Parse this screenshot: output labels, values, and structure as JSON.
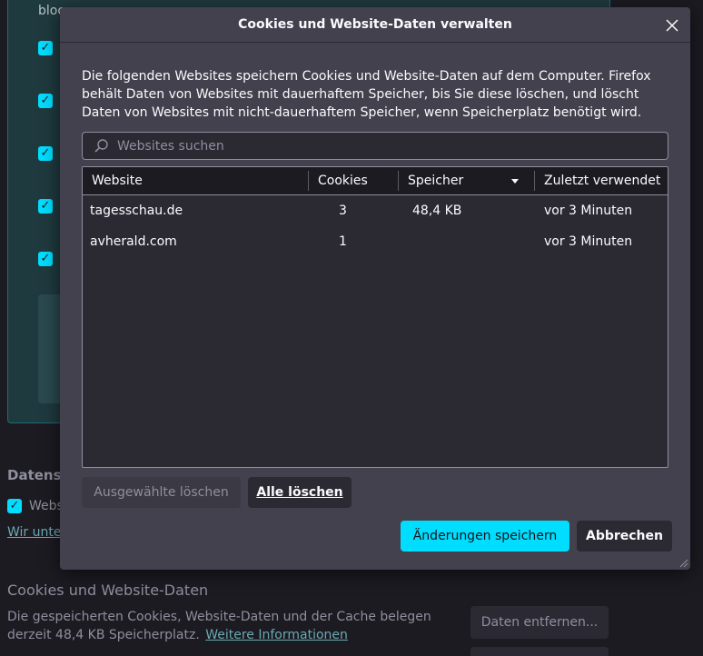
{
  "background": {
    "top_fragment": "bloc",
    "section_heading": "Datensc",
    "checkbox_label": "Webs",
    "link_fragment": "Wir unte",
    "cookies_heading": "Cookies und Website-Daten",
    "cookies_text_line1": "Die gespeicherten Cookies, Website-Daten und der Cache belegen",
    "cookies_text_line2": "derzeit 48,4 KB Speicherplatz.",
    "more_info_link": "Weitere Informationen",
    "remove_data_button": "Daten entfernen..."
  },
  "dialog": {
    "title": "Cookies und Website-Daten verwalten",
    "close_icon": "close-icon",
    "description": "Die folgenden Websites speichern Cookies und Website-Daten auf dem Computer. Firefox behält Daten von Websites mit dauerhaftem Speicher, bis Sie diese löschen, und löscht Daten von Websites mit nicht-dauerhaftem Speicher, wenn Speicherplatz benötigt wird.",
    "search": {
      "placeholder": "Websites suchen",
      "value": ""
    },
    "table": {
      "columns": [
        "Website",
        "Cookies",
        "Speicher",
        "Zuletzt verwendet"
      ],
      "sorted_column": "Speicher",
      "rows": [
        {
          "website": "tagesschau.de",
          "cookies": "3",
          "storage": "48,4 KB",
          "last_used": "vor 3 Minuten"
        },
        {
          "website": "avherald.com",
          "cookies": "1",
          "storage": "",
          "last_used": "vor 3 Minuten"
        }
      ]
    },
    "buttons": {
      "remove_selected": "Ausgewählte löschen",
      "remove_all": "Alle löschen",
      "save": "Änderungen speichern",
      "cancel": "Abbrechen"
    }
  },
  "colors": {
    "accent": "#00ddff",
    "dialog_bg": "#42414d",
    "table_bg": "#2b2a33",
    "page_bg": "#1c1b22"
  }
}
